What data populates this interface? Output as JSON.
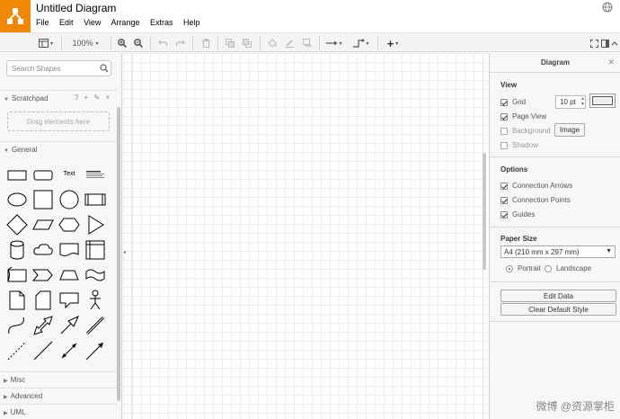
{
  "app": {
    "title": "Untitled Diagram",
    "menu": [
      "File",
      "Edit",
      "View",
      "Arrange",
      "Extras",
      "Help"
    ],
    "brand_color": "#f08705"
  },
  "toolbar": {
    "zoom_label": "100%"
  },
  "sidebar": {
    "search_placeholder": "Search Shapes",
    "scratchpad_label": "Scratchpad",
    "scratchpad_icons": "? + ✎ ×",
    "drop_hint": "Drag elements here",
    "general_label": "General",
    "text_shape_label": "Text",
    "sections": [
      "Misc",
      "Advanced",
      "UML"
    ]
  },
  "panel": {
    "title": "Diagram",
    "view_heading": "View",
    "grid_label": "Grid",
    "grid_size": "10 pt",
    "page_view_label": "Page View",
    "background_label": "Background",
    "image_button": "Image",
    "shadow_label": "Shadow",
    "options_heading": "Options",
    "connection_arrows_label": "Connection Arrows",
    "connection_points_label": "Connection Points",
    "guides_label": "Guides",
    "paper_heading": "Paper Size",
    "paper_value": "A4 (210 mm x 297 mm)",
    "portrait_label": "Portrait",
    "landscape_label": "Landscape",
    "edit_data_button": "Edit Data",
    "clear_style_button": "Clear Default Style",
    "checks": {
      "grid": true,
      "page_view": true,
      "background": false,
      "shadow": false,
      "connection_arrows": true,
      "connection_points": true,
      "guides": true
    },
    "orientation": "portrait"
  },
  "watermark": "微博 @资源掌柜"
}
